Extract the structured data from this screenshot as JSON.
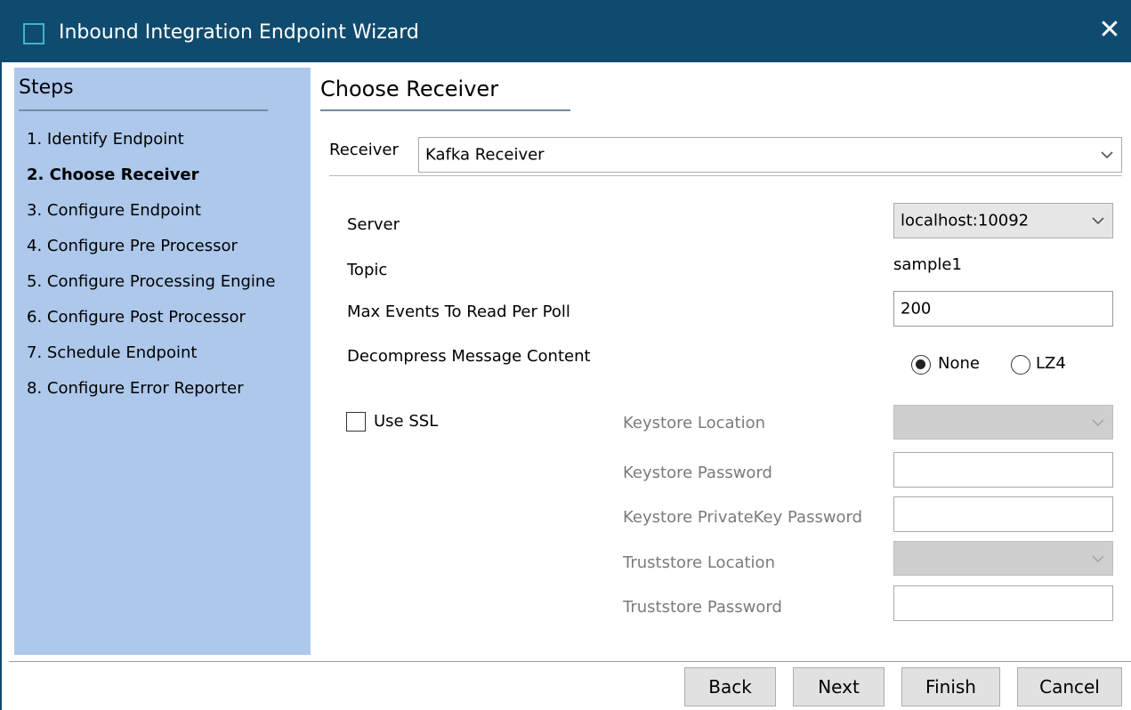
{
  "window": {
    "title": "Inbound Integration Endpoint Wizard",
    "close_glyph": "✕"
  },
  "steps": {
    "title": "Steps",
    "items": [
      {
        "label": "1. Identify Endpoint",
        "active": false
      },
      {
        "label": "2. Choose Receiver",
        "active": true
      },
      {
        "label": "3. Configure Endpoint",
        "active": false
      },
      {
        "label": "4. Configure Pre Processor",
        "active": false
      },
      {
        "label": "5. Configure Processing Engine",
        "active": false
      },
      {
        "label": "6. Configure Post Processor",
        "active": false
      },
      {
        "label": "7. Schedule Endpoint",
        "active": false
      },
      {
        "label": "8. Configure Error Reporter",
        "active": false
      }
    ]
  },
  "main": {
    "title": "Choose Receiver",
    "receiver": {
      "label": "Receiver",
      "value": "Kafka Receiver"
    },
    "server": {
      "label": "Server",
      "value": "localhost:10092"
    },
    "topic": {
      "label": "Topic",
      "value": "sample1"
    },
    "max_events": {
      "label": "Max Events To Read Per Poll",
      "value": "200"
    },
    "decompress": {
      "label": "Decompress Message Content",
      "options": [
        {
          "label": "None",
          "selected": true
        },
        {
          "label": "LZ4",
          "selected": false
        }
      ]
    },
    "ssl": {
      "label": "Use SSL",
      "checked": false,
      "keystore_location": {
        "label": "Keystore Location",
        "value": ""
      },
      "keystore_password": {
        "label": "Keystore Password",
        "value": ""
      },
      "keystore_privatekey_password": {
        "label": "Keystore PrivateKey Password",
        "value": ""
      },
      "truststore_location": {
        "label": "Truststore Location",
        "value": ""
      },
      "truststore_password": {
        "label": "Truststore Password",
        "value": ""
      }
    }
  },
  "buttons": {
    "back": "Back",
    "next": "Next",
    "finish": "Finish",
    "cancel": "Cancel"
  },
  "colors": {
    "titlebar": "#0f4b6e",
    "steps_panel": "#adc8eb",
    "accent": "#3fb6c9"
  }
}
